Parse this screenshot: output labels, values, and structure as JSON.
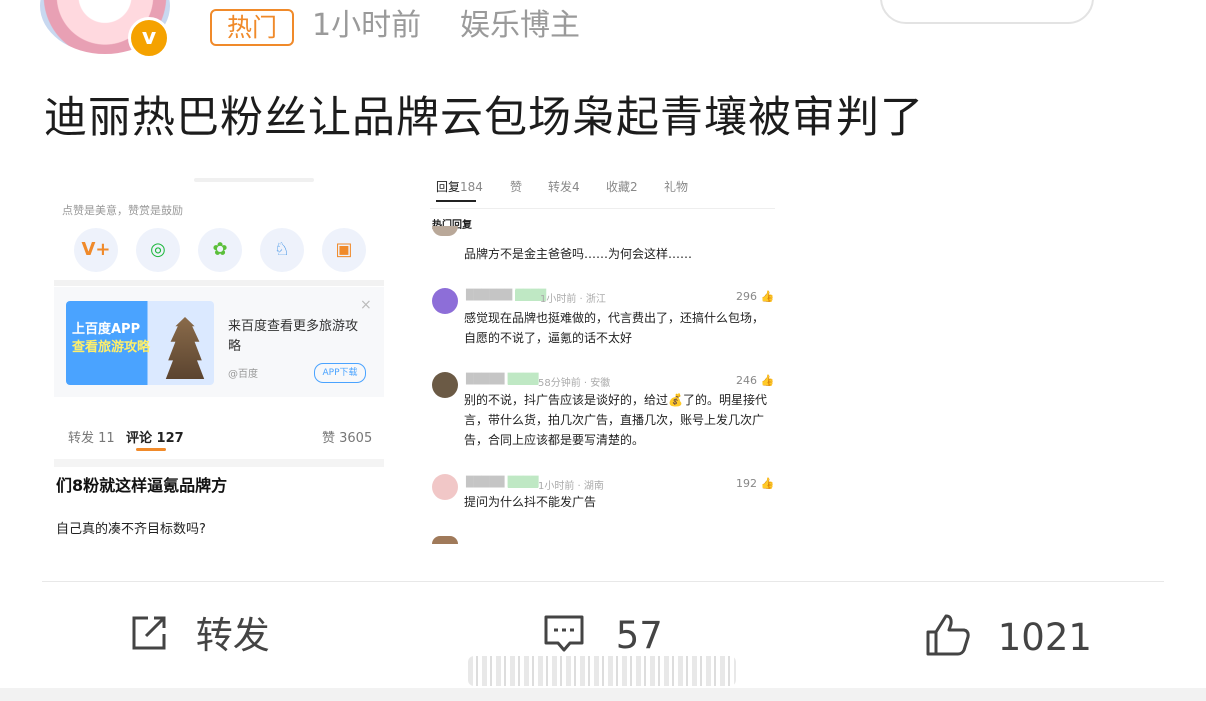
{
  "header": {
    "hot_tag": "热门",
    "time": "1小时前",
    "author_type": "娱乐博主",
    "verified_badge": "v"
  },
  "post": {
    "title": "迪丽热巴粉丝让品牌云包场枭起青壤被审判了"
  },
  "left_screenshot": {
    "share_caption": "点赞是美意，赞赏是鼓励",
    "share_icons": [
      "v-plus-icon",
      "wechat-icon",
      "moments-icon",
      "qq-icon",
      "image-share-icon"
    ],
    "ad": {
      "badge_line1": "上百度APP",
      "badge_line2": "查看旅游攻略",
      "text": "来百度查看更多旅游攻略",
      "source": "@百度",
      "button": "APP下载"
    },
    "tabs": {
      "repost": "转发 11",
      "comment": "评论 127",
      "like": "赞 3605"
    },
    "heading": "们8粉就这样逼氪品牌方",
    "question": "自己真的凑不齐目标数吗?"
  },
  "right_screenshot": {
    "tabs": [
      {
        "label": "回复",
        "count": "184"
      },
      {
        "label": "赞",
        "count": ""
      },
      {
        "label": "转发",
        "count": "4"
      },
      {
        "label": "收藏",
        "count": "2"
      },
      {
        "label": "礼物",
        "count": ""
      }
    ],
    "hot_replies_label": "热门回复",
    "comments": [
      {
        "time": "",
        "likes": "",
        "text": "品牌方不是金主爸爸吗……为何会这样……",
        "avatar_color": "#b9a899"
      },
      {
        "time": "1小时前 · 浙江",
        "likes": "296",
        "text": "感觉现在品牌也挺难做的，代言费出了，还搞什么包场，自愿的不说了，逼氪的话不太好",
        "avatar_color": "#8d6ed8"
      },
      {
        "time": "58分钟前 · 安徽",
        "likes": "246",
        "text": "别的不说，抖广告应该是谈好的，给过💰了的。明星接代言，带什么货，拍几次广告，直播几次，账号上发几次广告，合同上应该都是要写清楚的。",
        "avatar_color": "#6b5a45"
      },
      {
        "time": "1小时前 · 湖南",
        "likes": "192",
        "text": "提问为什么抖不能发广告",
        "avatar_color": "#f1c7c7"
      }
    ]
  },
  "actions": {
    "repost": "转发",
    "comments": "57",
    "likes": "1021"
  },
  "colors": {
    "accent": "#f08a2a",
    "badge": "#f5a200",
    "link": "#4aa3ff"
  }
}
